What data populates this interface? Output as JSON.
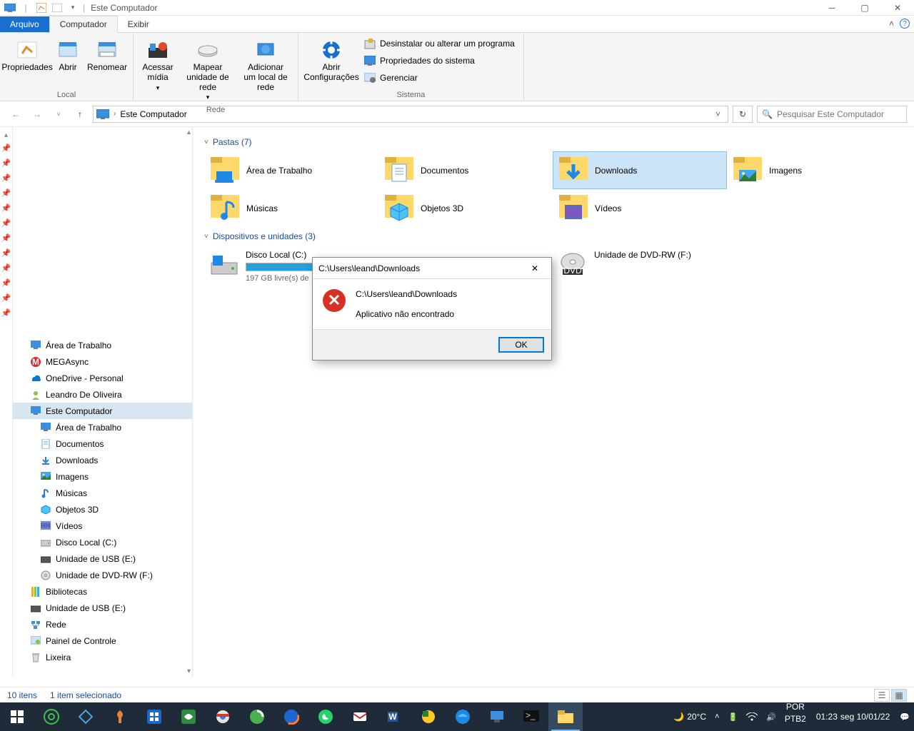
{
  "window": {
    "title": "Este Computador"
  },
  "tabs": {
    "file": "Arquivo",
    "computer": "Computador",
    "view": "Exibir"
  },
  "ribbon": {
    "local": {
      "label": "Local",
      "properties": "Propriedades",
      "open": "Abrir",
      "rename": "Renomear"
    },
    "network": {
      "label": "Rede",
      "access_media": "Acessar mídia",
      "map_drive": "Mapear unidade de rede",
      "add_location": "Adicionar um local de rede"
    },
    "system": {
      "label": "Sistema",
      "open_settings": "Abrir Configurações",
      "uninstall": "Desinstalar ou alterar um programa",
      "sys_props": "Propriedades do sistema",
      "manage": "Gerenciar"
    }
  },
  "address": {
    "location": "Este Computador"
  },
  "search": {
    "placeholder": "Pesquisar Este Computador"
  },
  "content": {
    "folders_header": "Pastas (7)",
    "drives_header": "Dispositivos e unidades (3)",
    "folders": [
      {
        "name": "Área de Trabalho"
      },
      {
        "name": "Documentos"
      },
      {
        "name": "Downloads",
        "selected": true
      },
      {
        "name": "Imagens"
      },
      {
        "name": "Músicas"
      },
      {
        "name": "Objetos 3D"
      },
      {
        "name": "Vídeos"
      }
    ],
    "drives": [
      {
        "name": "Disco Local (C:)",
        "free": "197 GB livre(s) de ...",
        "fill": 60
      },
      {
        "name": "Unidade de DVD-RW (F:)"
      }
    ]
  },
  "tree": [
    {
      "label": "Área de Trabalho",
      "icon": "desktop",
      "indent": 0
    },
    {
      "label": "MEGAsync",
      "icon": "mega",
      "indent": 0
    },
    {
      "label": "OneDrive - Personal",
      "icon": "onedrive",
      "indent": 0
    },
    {
      "label": "Leandro De Oliveira",
      "icon": "user",
      "indent": 0
    },
    {
      "label": "Este Computador",
      "icon": "pc",
      "indent": 0,
      "selected": true
    },
    {
      "label": "Área de Trabalho",
      "icon": "desktop",
      "indent": 1
    },
    {
      "label": "Documentos",
      "icon": "doc",
      "indent": 1
    },
    {
      "label": "Downloads",
      "icon": "dl",
      "indent": 1
    },
    {
      "label": "Imagens",
      "icon": "img",
      "indent": 1
    },
    {
      "label": "Músicas",
      "icon": "music",
      "indent": 1
    },
    {
      "label": "Objetos 3D",
      "icon": "3d",
      "indent": 1
    },
    {
      "label": "Vídeos",
      "icon": "vid",
      "indent": 1
    },
    {
      "label": "Disco Local (C:)",
      "icon": "drive",
      "indent": 1
    },
    {
      "label": "Unidade de USB (E:)",
      "icon": "usb",
      "indent": 1
    },
    {
      "label": "Unidade de DVD-RW (F:)",
      "icon": "dvd",
      "indent": 1
    },
    {
      "label": "Bibliotecas",
      "icon": "lib",
      "indent": 0
    },
    {
      "label": "Unidade de USB (E:)",
      "icon": "usb",
      "indent": 0
    },
    {
      "label": "Rede",
      "icon": "net",
      "indent": 0
    },
    {
      "label": "Painel de Controle",
      "icon": "ctrl",
      "indent": 0
    },
    {
      "label": "Lixeira",
      "icon": "trash",
      "indent": 0
    }
  ],
  "dialog": {
    "title": "C:\\Users\\leand\\Downloads",
    "heading": "C:\\Users\\leand\\Downloads",
    "message": "Aplicativo não encontrado",
    "ok": "OK"
  },
  "status": {
    "count": "10 itens",
    "selection": "1 item selecionado"
  },
  "tray": {
    "weather_temp": "20°C",
    "lang1": "POR",
    "lang2": "PTB2",
    "time": "01:23",
    "date": "seg 10/01/22"
  }
}
